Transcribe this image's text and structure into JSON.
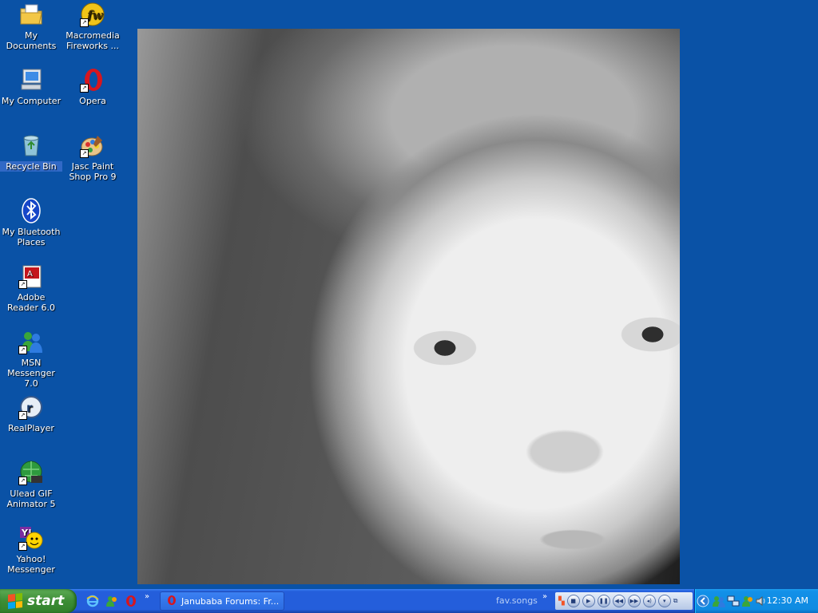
{
  "desktop": {
    "icons": [
      {
        "label": "My Documents",
        "icon": "my-documents-icon"
      },
      {
        "label": "Macromedia Fireworks ...",
        "icon": "fireworks-icon"
      },
      {
        "label": "My Computer",
        "icon": "my-computer-icon"
      },
      {
        "label": "Opera",
        "icon": "opera-icon"
      },
      {
        "label": "Recycle Bin",
        "icon": "recycle-bin-icon"
      },
      {
        "label": "Jasc Paint Shop Pro 9",
        "icon": "paint-shop-pro-icon"
      },
      {
        "label": "My Bluetooth Places",
        "icon": "bluetooth-icon"
      },
      {
        "label": "Adobe Reader 6.0",
        "icon": "adobe-reader-icon"
      },
      {
        "label": "MSN Messenger 7.0",
        "icon": "msn-messenger-icon"
      },
      {
        "label": "RealPlayer",
        "icon": "realplayer-icon"
      },
      {
        "label": "Ulead GIF Animator 5",
        "icon": "ulead-gif-icon"
      },
      {
        "label": "Yahoo! Messenger",
        "icon": "yahoo-messenger-icon"
      }
    ],
    "wallpaper": "black-and-white baby portrait"
  },
  "taskbar": {
    "start_label": "start",
    "quick_launch_chevron": "»",
    "tasks": [
      {
        "label": "Janubaba Forums: Fr...",
        "icon": "opera-icon"
      }
    ],
    "toolbar_title": "fav.songs",
    "toolbar_chevron": "»",
    "clock": "12:30 AM"
  },
  "colors": {
    "desktop_bg": "#0a52a6",
    "taskbar": "#245edb",
    "start_green": "#3c8d35",
    "tray": "#0f8be1"
  }
}
